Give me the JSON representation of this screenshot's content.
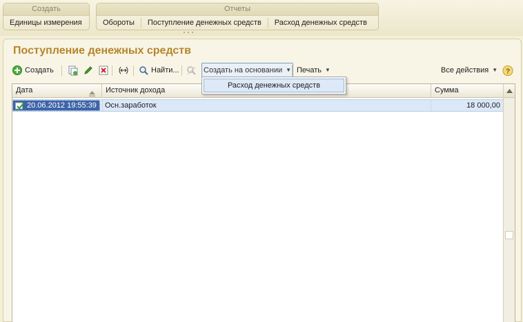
{
  "top_panel": {
    "create_group": {
      "title": "Создать",
      "items": [
        "Единицы измерения"
      ]
    },
    "reports_group": {
      "title": "Отчеты",
      "items": [
        "Обороты",
        "Поступление денежных средств",
        "Расход денежных средств"
      ]
    }
  },
  "form": {
    "title": "Поступление денежных средств"
  },
  "toolbar": {
    "create_label": "Создать",
    "find_label": "Найти...",
    "create_based_on_label": "Создать на основании",
    "print_label": "Печать",
    "all_actions_label": "Все действия",
    "help_label": "?"
  },
  "dropdown": {
    "items": [
      "Расход денежных средств"
    ]
  },
  "table": {
    "columns": [
      "Дата",
      "Источник дохода",
      "Сумма"
    ],
    "rows": [
      {
        "date": "20.06.2012 19:55:39",
        "source": "Осн.заработок",
        "sum": "18 000,00"
      }
    ]
  },
  "colors": {
    "title": "#b7852a",
    "selected_cell": "#3d64a8",
    "row_highlight": "#dbe8f7",
    "background": "#f3efd9"
  }
}
